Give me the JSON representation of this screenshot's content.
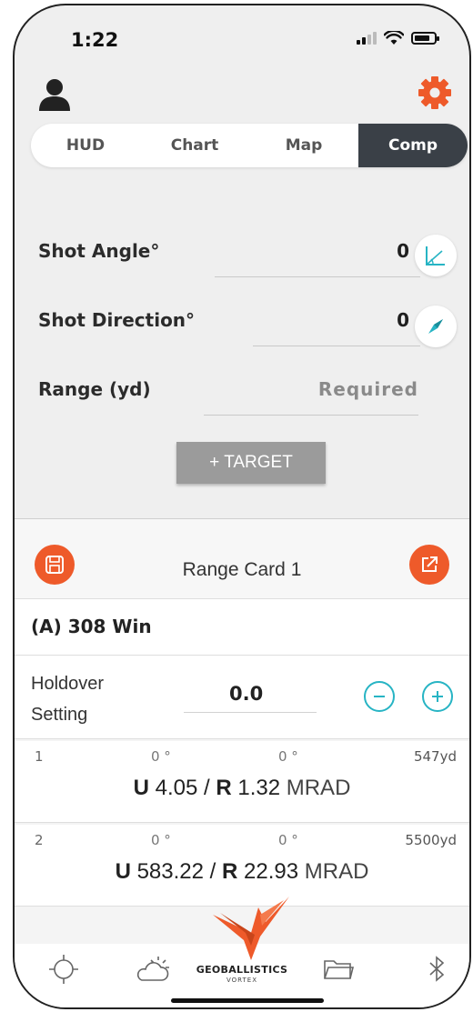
{
  "status_bar": {
    "time": "1:22"
  },
  "header": {
    "profile_icon": "person-icon",
    "settings_icon": "gear-icon",
    "accent_color": "#ee5a2a"
  },
  "tabs": [
    {
      "label": "HUD",
      "active": false
    },
    {
      "label": "Chart",
      "active": false
    },
    {
      "label": "Map",
      "active": false
    },
    {
      "label": "Comp",
      "active": true
    }
  ],
  "form": {
    "shot_angle": {
      "label": "Shot Angle°",
      "value": "0"
    },
    "shot_direction": {
      "label": "Shot Direction°",
      "value": "0"
    },
    "range": {
      "label": "Range (yd)",
      "placeholder": "Required"
    },
    "add_target_label": "+ TARGET"
  },
  "range_card": {
    "title": "Range Card 1",
    "ammo": "(A) 308 Win",
    "holdover": {
      "label_line1": "Holdover",
      "label_line2": "Setting",
      "value": "0.0"
    },
    "rows": [
      {
        "index": "1",
        "angle": "0 °",
        "direction": "0 °",
        "distance": "547yd",
        "up_label": "U",
        "up_value": "4.05",
        "sep": "/",
        "right_label": "R",
        "right_value": "1.32",
        "unit": "MRAD"
      },
      {
        "index": "2",
        "angle": "0 °",
        "direction": "0 °",
        "distance": "5500yd",
        "up_label": "U",
        "up_value": "583.22",
        "sep": "/",
        "right_label": "R",
        "right_value": "22.93",
        "unit": "MRAD"
      }
    ]
  },
  "bottom_nav": {
    "items": [
      "crosshair-icon",
      "weather-icon",
      "folder-icon",
      "bluetooth-icon"
    ],
    "logo_text": "GEOBALLISTICS",
    "logo_sub": "VORTEX"
  }
}
